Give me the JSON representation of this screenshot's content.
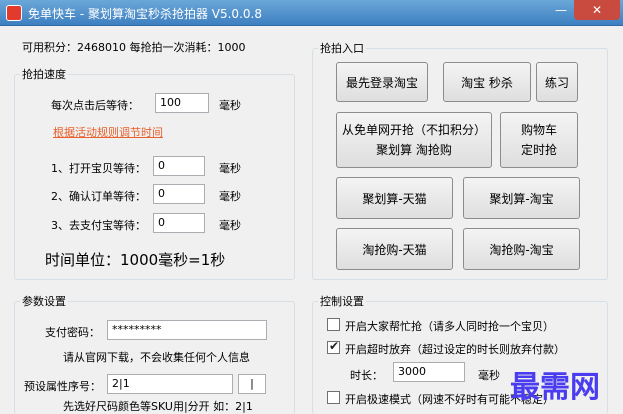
{
  "window": {
    "title": "免单快车 - 聚划算淘宝秒杀抢拍器 V5.0.0.8",
    "minimize_glyph": "—",
    "close_glyph": "✕"
  },
  "header": {
    "points": "可用积分：2468010  每抢拍一次消耗：1000"
  },
  "speed_group": {
    "title": "抢拍速度",
    "wait_after_click_label": "每次点击后等待：",
    "wait_after_click_value": "100",
    "wait_after_click_unit": "毫秒",
    "adjust_link": "根据活动规则调节时间",
    "open_item_label": "1、打开宝贝等待：",
    "open_item_value": "0",
    "open_item_unit": "毫秒",
    "confirm_order_label": "2、确认订单等待：",
    "confirm_order_value": "0",
    "confirm_order_unit": "毫秒",
    "go_pay_label": "3、去支付宝等待：",
    "go_pay_value": "0",
    "go_pay_unit": "毫秒",
    "time_unit_note": "时间单位：1000毫秒=1秒"
  },
  "entry_group": {
    "title": "抢拍入口",
    "login_taobao": "最先登录淘宝",
    "taobao_seckill": "淘宝   秒杀",
    "practice": "练习",
    "free_line1": "从免单网开抢（不扣积分）",
    "free_line2": "聚划算      淘抢购",
    "cart_line1": "购物车",
    "cart_line2": "定时抢",
    "juhuasuan_tmall": "聚划算-天猫",
    "juhuasuan_taobao": "聚划算-淘宝",
    "taoqianggou_tmall": "淘抢购-天猫",
    "taoqianggou_taobao": "淘抢购-淘宝"
  },
  "params_group": {
    "title": "参数设置",
    "pay_password_label": "支付密码：",
    "pay_password_value": "*********",
    "download_note": "请从官网下载，不会收集任何个人信息",
    "preset_attr_label": "预设属性序号：",
    "preset_attr_value": "2|1",
    "preset_attr_extra": "|",
    "preset_attr_hint": "先选好尺码颜色等SKU用|分开  如：2|1"
  },
  "control_group": {
    "title": "控制设置",
    "help_grab_label": "开启大家帮忙抢（请多人同时抢一个宝贝）",
    "help_grab_checked": false,
    "timeout_label": "开启超时放弃（超过设定的时长则放弃付款）",
    "timeout_checked": true,
    "duration_label": "时长：",
    "duration_value": "3000",
    "duration_unit": "毫秒",
    "fast_mode_label": "开启极速模式（网速不好时有可能不稳定）",
    "fast_mode_checked": false
  },
  "watermark": "最需网"
}
